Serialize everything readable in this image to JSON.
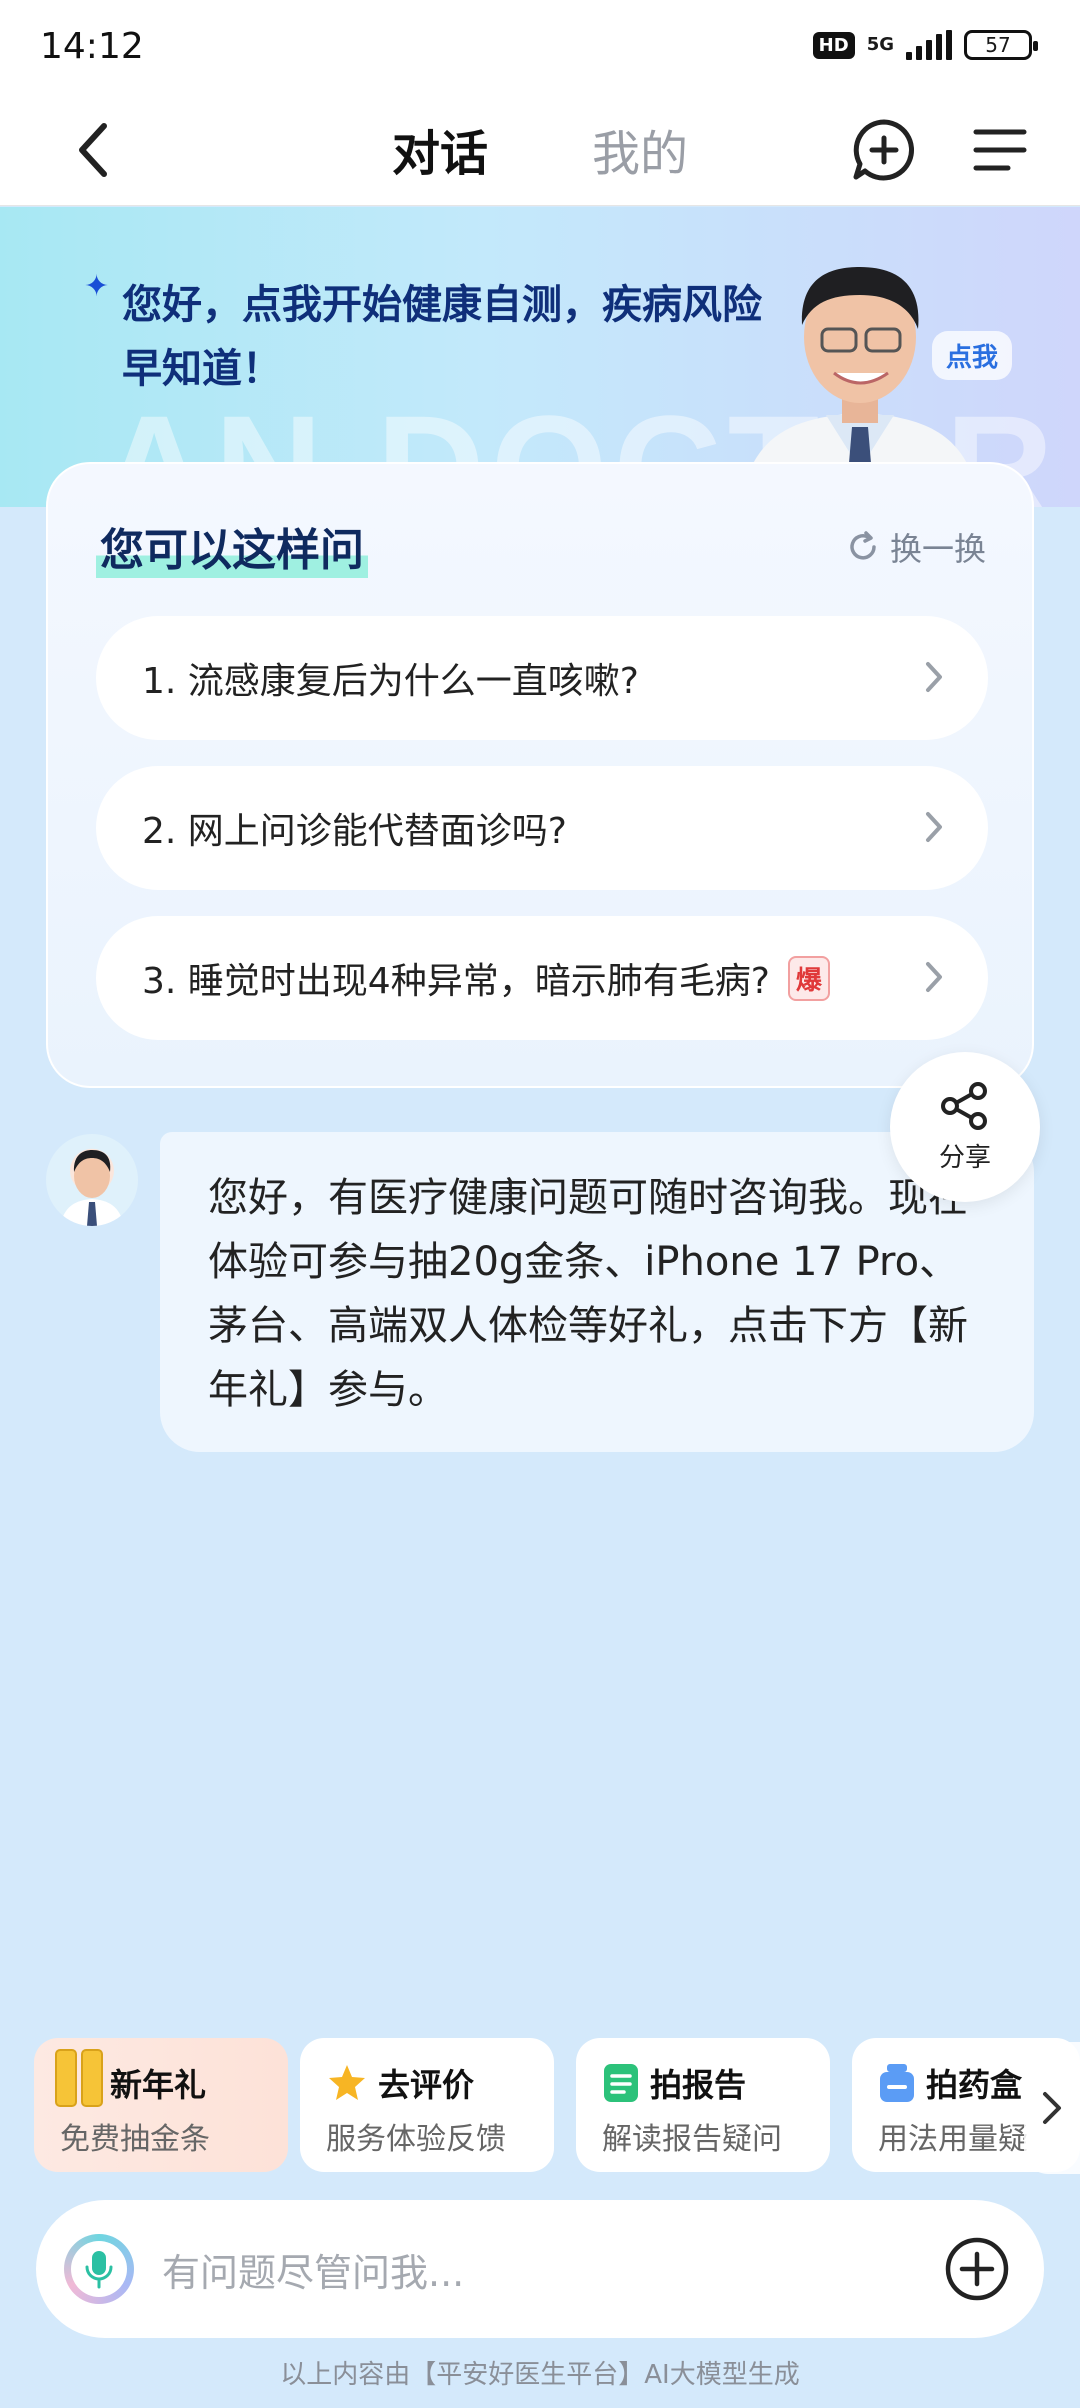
{
  "status_bar": {
    "time": "14:12",
    "hd": "HD",
    "network": "5G",
    "battery": "57"
  },
  "nav": {
    "tab_active": "对话",
    "tab_inactive": "我的"
  },
  "banner": {
    "text": "您好，点我开始健康自测，疾病风险早知道！",
    "badge": "点我",
    "watermark": "AN DOCTOR"
  },
  "suggestions": {
    "title": "您可以这样问",
    "refresh": "换一换",
    "items": [
      {
        "text": "1. 流感康复后为什么一直咳嗽?"
      },
      {
        "text": "2. 网上问诊能代替面诊吗?"
      },
      {
        "text": "3. 睡觉时出现4种异常，暗示肺有毛病?",
        "badge": "爆"
      }
    ]
  },
  "share": {
    "label": "分享"
  },
  "chat": {
    "message": "您好，有医疗健康问题可随时咨询我。现在体验可参与抽20g金条、iPhone 17 Pro、茅台、高端双人体检等好礼，点击下方【新年礼】参与。"
  },
  "quick_actions": [
    {
      "title": "新年礼",
      "sub": "免费抽金条"
    },
    {
      "title": "去评价",
      "sub": "服务体验反馈"
    },
    {
      "title": "拍报告",
      "sub": "解读报告疑问"
    },
    {
      "title": "拍药盒",
      "sub": "用法用量疑"
    }
  ],
  "input": {
    "placeholder": "有问题尽管问我..."
  },
  "footer": "以上内容由【平安好医生平台】AI大模型生成"
}
